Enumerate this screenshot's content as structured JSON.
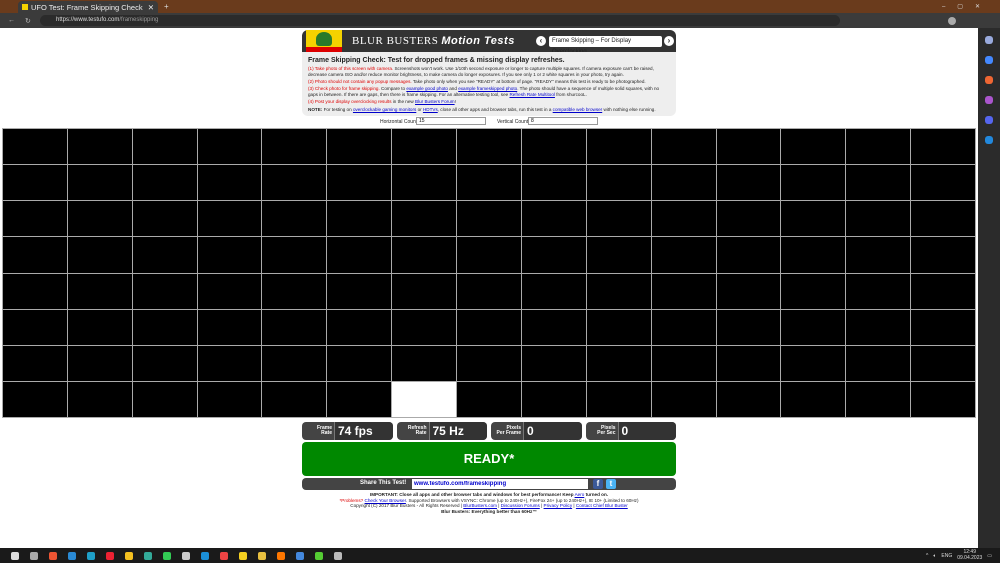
{
  "browser": {
    "tab_title": "UFO Test: Frame Skipping Check",
    "url_host": "https://www.testufo.com",
    "url_path": "/frameskipping"
  },
  "header": {
    "brand": "BLUR BUSTERS",
    "brand_suffix": "Motion Tests",
    "test_select": "Frame Skipping – For Display Overclocking"
  },
  "info": {
    "title": "Frame Skipping Check: Test for dropped frames & missing display refreshes.",
    "step1_label": "(1) Take photo of this screen with camera.",
    "step1_text": "Screenshots won't work. Use 1/10th second exposure or longer to capture multiple squares. If camera exposure can't be raised, decrease camera ISO and/or reduce monitor brightness, to make camera do longer exposures. If you see only 1 or 2 white squares in your photo, try again.",
    "step2_label": "(2) Photo should not contain any popup messages.",
    "step2_text": "Take photo only when you see \"READY\" at bottom of page. \"READY\" means this test is ready to be photographed.",
    "step3_label": "(3) Check photo for frame skipping.",
    "step3_a": "Compare to",
    "step3_link1": "example good photo",
    "step3_b": "and",
    "step3_link2": "example frameskipped photo",
    "step3_c": ". The photo should have a sequence of multiple solid squares, with no gaps in between. If there are gaps, then there is frame skipping. For an alternative testing tool, see",
    "step3_link3": "Refresh Rate Multitool",
    "step3_d": "from shurcooL.",
    "step4_label": "(4) Post your display overclocking results",
    "step4_a": "in the new",
    "step4_link": "Blur Busters Forum",
    "step4_b": "!",
    "note_label": "NOTE:",
    "note_a": "For testing on",
    "note_link1": "overclockable gaming monitors",
    "note_b": "or",
    "note_link2": "HDTVs",
    "note_c": ", close all other apps and browser tabs, run this test in a",
    "note_link3": "compatible web browser",
    "note_d": "with nothing else running."
  },
  "counts": {
    "horizontal_label": "Horizontal Count:",
    "horizontal_value": "15",
    "vertical_label": "Vertical Count:",
    "vertical_value": "8"
  },
  "grid": {
    "columns": 15,
    "rows": 8,
    "lit_cell": {
      "row": 8,
      "column": 7
    }
  },
  "stats": [
    {
      "label": "Frame\nRate",
      "value": "74 fps"
    },
    {
      "label": "Refresh\nRate",
      "value": "75 Hz"
    },
    {
      "label": "Pixels\nPer Frame",
      "value": "0"
    },
    {
      "label": "Pixels\nPer Sec",
      "value": "0"
    }
  ],
  "status": "READY*",
  "share": {
    "label": "Share This Test!",
    "url": "www.testufo.com/frameskipping",
    "facebook": "f",
    "twitter": "t"
  },
  "footer": {
    "important_bold": "IMPORTANT:",
    "important_text": "Close all apps and other browser tabs and windows for best performance! Keep",
    "aero_link": "Aero",
    "important_end": "turned on.",
    "problems": "*Problems?",
    "check_link": "Check Your Browser",
    "supported": ". Supported Browsers with VSYNC: Chrome (up to 240Hz+), FireFox 24+ (up to 240Hz+), IE 10+ (Limited to 60Hz)",
    "copyright": "Copyright (C) 2017 Blur Busters - All Rights Reserved |",
    "link_bb": "BlurBusters.com",
    "link_forums": "Discussion Forums",
    "link_privacy": "Privacy Policy",
    "link_contact": "Contact Chief Blur Buster",
    "slogan": "Blur Busters: Everything better than 60Hz™"
  },
  "taskbar": {
    "icon_colors": [
      "#ddd",
      "#aaa",
      "#e53",
      "#2a8ad4",
      "#1fa0c8",
      "#e23",
      "#f4c020",
      "#3a9",
      "#3c5",
      "#ccc",
      "#1b8fd8",
      "#e44",
      "#f5d020",
      "#e8c040",
      "#f70",
      "#48d",
      "#5c3",
      "#bbb"
    ],
    "language": "ENG",
    "time": "12:49",
    "date": "09.04.2023"
  }
}
